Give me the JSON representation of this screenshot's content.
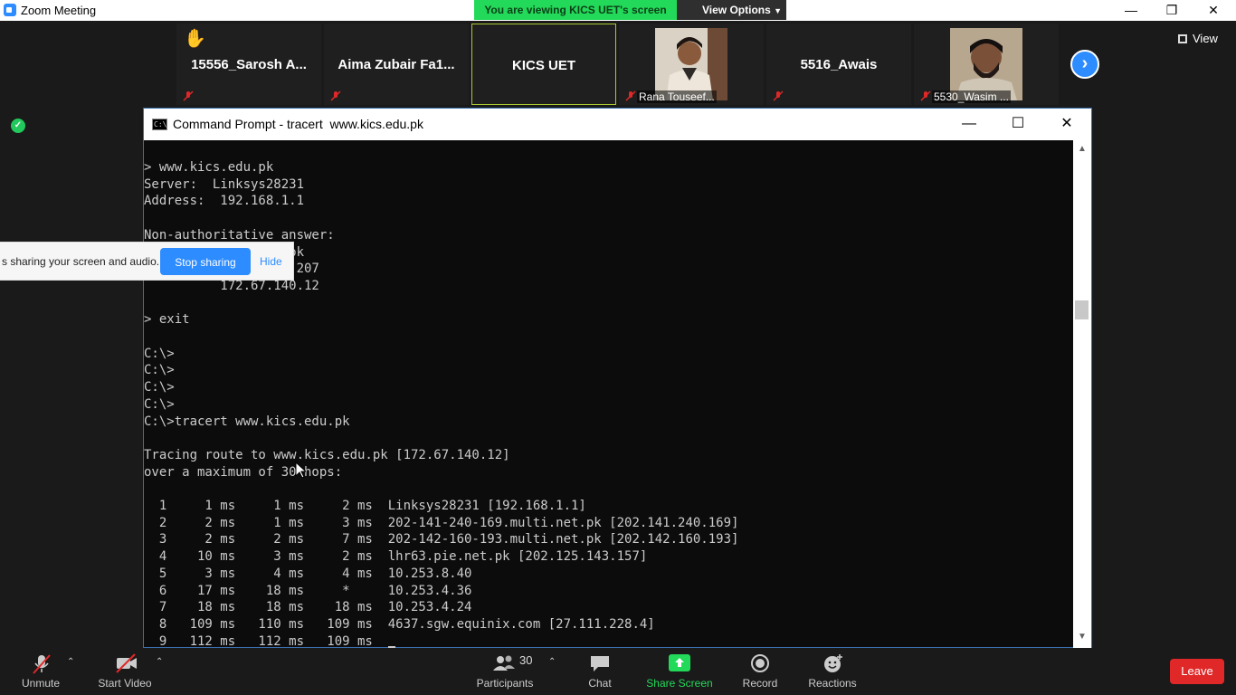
{
  "zoom": {
    "title": "Zoom Meeting",
    "viewing_banner": "You are viewing KICS UET's screen",
    "view_options": "View Options",
    "view_label": "View",
    "participants_tiles": [
      {
        "name": "15556_Sarosh A...",
        "raised_hand": true
      },
      {
        "name": "Aima Zubair Fa1..."
      },
      {
        "name": "KICS UET"
      },
      {
        "name": "Rana Touseef..."
      },
      {
        "name": "5516_Awais"
      },
      {
        "name": "5530_Wasim ..."
      }
    ],
    "hand_emoji": "✋"
  },
  "cmd": {
    "title": "Command Prompt - tracert  www.kics.edu.pk",
    "icon_text": "C:\\",
    "lines": [
      "> www.kics.edu.pk",
      "Server:  Linksys28231",
      "Address:  192.168.1.1",
      "",
      "Non-authoritative answer:",
      "          kics.edu.pk",
      "          104.21.94.207",
      "          172.67.140.12",
      "",
      "> exit",
      "",
      "C:\\>",
      "C:\\>",
      "C:\\>",
      "C:\\>",
      "C:\\>tracert www.kics.edu.pk",
      "",
      "Tracing route to www.kics.edu.pk [172.67.140.12]",
      "over a maximum of 30 hops:",
      "",
      "  1     1 ms     1 ms     2 ms  Linksys28231 [192.168.1.1]",
      "  2     2 ms     1 ms     3 ms  202-141-240-169.multi.net.pk [202.141.240.169]",
      "  3     2 ms     2 ms     7 ms  202-142-160-193.multi.net.pk [202.142.160.193]",
      "  4    10 ms     3 ms     2 ms  lhr63.pie.net.pk [202.125.143.157]",
      "  5     3 ms     4 ms     4 ms  10.253.8.40",
      "  6    17 ms    18 ms     *     10.253.4.36",
      "  7    18 ms    18 ms    18 ms  10.253.4.24",
      "  8   109 ms   110 ms   109 ms  4637.sgw.equinix.com [27.111.228.4]",
      "  9   112 ms   112 ms   109 ms  "
    ]
  },
  "share_popup": {
    "message": "s sharing your screen and audio.",
    "stop_label": "Stop sharing",
    "hide_label": "Hide"
  },
  "toolbar": {
    "unmute": "Unmute",
    "start_video": "Start Video",
    "participants": "Participants",
    "participant_count": "30",
    "chat": "Chat",
    "share_screen": "Share Screen",
    "record": "Record",
    "reactions": "Reactions",
    "leave": "Leave"
  },
  "colors": {
    "zoom_blue": "#2d8cff",
    "banner_green": "#23d959",
    "leave_red": "#e02828",
    "console_text": "#cccccc",
    "console_bg": "#0c0c0c"
  }
}
